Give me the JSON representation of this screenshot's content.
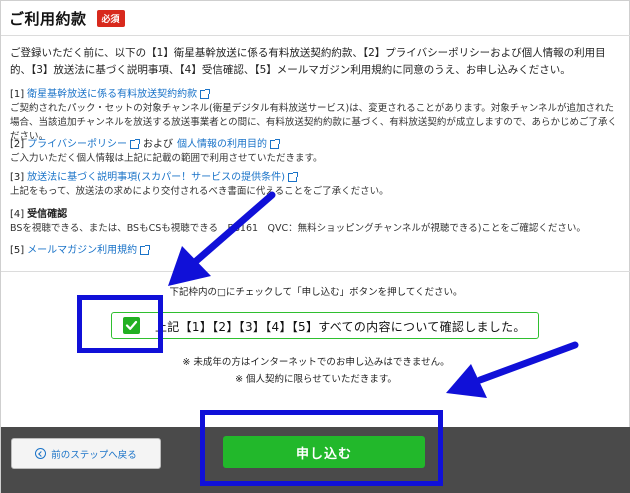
{
  "header": {
    "title": "ご利用約款",
    "badge": "必須"
  },
  "intro": "ご登録いただく前に、以下の【1】衛星基幹放送に係る有料放送契約約款、【2】プライバシーポリシーおよび個人情報の利用目的、【3】放送法に基づく説明事項、【4】受信確認、【5】メールマガジン利用規約に同意のうえ、お申し込みください。",
  "sections": {
    "s1": {
      "num": "[1]",
      "link": "衛星基幹放送に係る有料放送契約約款",
      "body": "ご契約されたパック・セットの対象チャンネル(衛星デジタル有料放送サービス)は、変更されることがあります。対象チャンネルが追加された場合、当該追加チャンネルを放送する放送事業者との間に、有料放送契約約款に基づく、有料放送契約が成立しますので、あらかじめご了承ください。"
    },
    "s2": {
      "num": "[2]",
      "link": "プライバシーポリシー",
      "and": "および",
      "link2": "個人情報の利用目的",
      "body": "ご入力いただく個人情報は上記に記載の範囲で利用させていただきます。"
    },
    "s3": {
      "num": "[3]",
      "link": "放送法に基づく説明事項(スカパー！サービスの提供条件)",
      "body": "上記をもって、放送法の求めにより交付されるべき書面に代えることをご了承ください。"
    },
    "s4": {
      "num": "[4]",
      "title": "受信確認",
      "body": "BSを視聴できる、または、BSもCSも視聴できる　BS161　QVC：無料ショッピングチャンネルが視聴できる)ことをご確認ください。"
    },
    "s5": {
      "num": "[5]",
      "link": "メールマガジン利用規約"
    }
  },
  "agreement": {
    "instruction": "下記枠内の□にチェックして「申し込む」ボタンを押してください。",
    "checkbox_label": "上記【1】【2】【3】【4】【5】すべての内容について確認しました。",
    "checked": true
  },
  "notes": [
    "※ 未成年の方はインターネットでのお申し込みはできません。",
    "※ 個人契約に限らせていただきます。"
  ],
  "footer": {
    "back_label": "前のステップへ戻る",
    "submit_label": "申し込む"
  },
  "colors": {
    "accent_green": "#22b82b",
    "link_blue": "#1a73c8",
    "annotation_blue": "#1010d8",
    "badge_red": "#d8291d"
  }
}
